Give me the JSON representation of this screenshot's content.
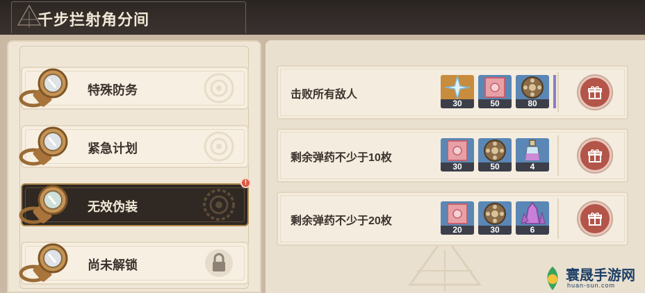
{
  "header": {
    "title": "千步拦射角分间"
  },
  "menu": {
    "items": [
      {
        "label": "特殊防务",
        "state": "normal"
      },
      {
        "label": "紧急计划",
        "state": "normal"
      },
      {
        "label": "无效伪装",
        "state": "active",
        "alert": "!"
      },
      {
        "label": "尚未解锁",
        "state": "locked"
      }
    ]
  },
  "tasks": [
    {
      "desc": "击败所有敌人",
      "rewards": [
        {
          "icon": "crystal-star-icon",
          "count": "30"
        },
        {
          "icon": "pink-flower-card-icon",
          "count": "50"
        },
        {
          "icon": "film-reel-coin-icon",
          "count": "80"
        }
      ]
    },
    {
      "desc": "剩余弹药不少于10枚",
      "rewards": [
        {
          "icon": "pink-flower-card-icon",
          "count": "30"
        },
        {
          "icon": "film-reel-coin-icon",
          "count": "50"
        },
        {
          "icon": "potion-bottle-icon",
          "count": "4"
        }
      ]
    },
    {
      "desc": "剩余弹药不少于20枚",
      "rewards": [
        {
          "icon": "pink-flower-card-icon",
          "count": "20"
        },
        {
          "icon": "film-reel-coin-icon",
          "count": "30"
        },
        {
          "icon": "purple-crystal-icon",
          "count": "6"
        }
      ]
    }
  ],
  "watermark": {
    "text": "寰晟手游网",
    "sub": "huan-sun.com"
  },
  "colors": {
    "claim_button": "#b4554a",
    "active_card": "#2f2823",
    "count_bar": "#3c3f4a"
  }
}
